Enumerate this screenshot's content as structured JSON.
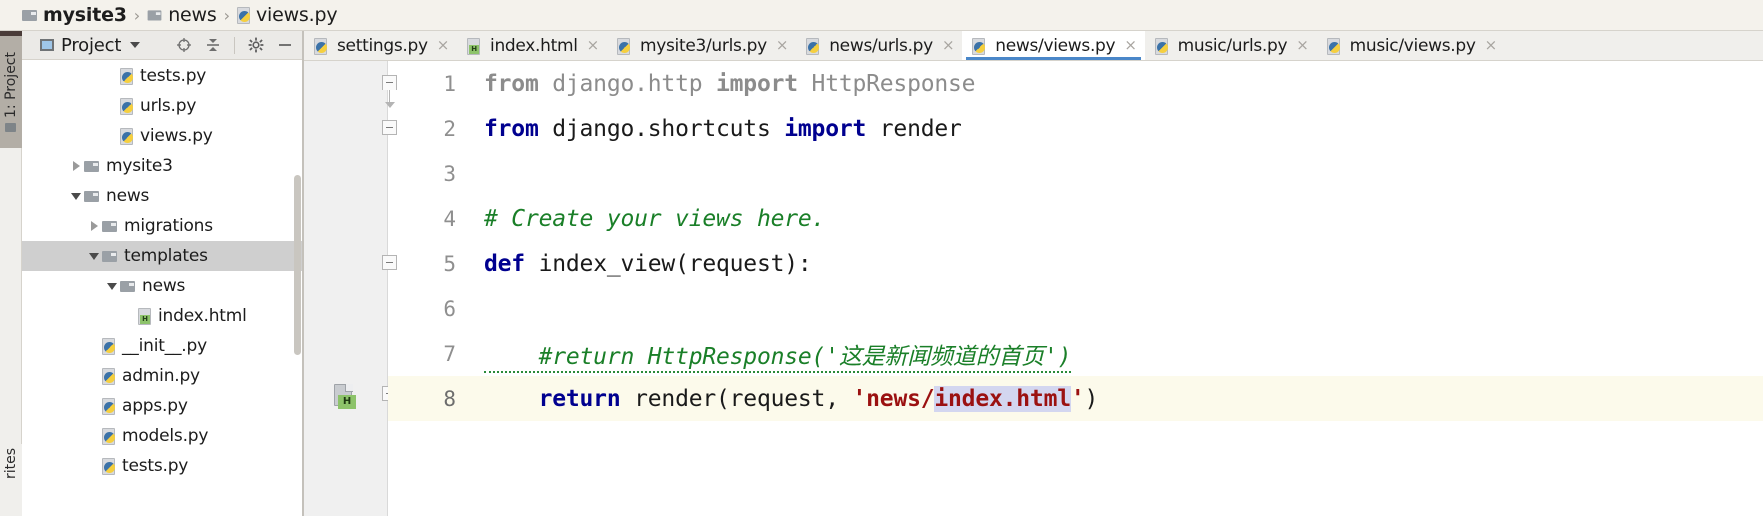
{
  "window": {
    "app": "PyCharm",
    "accent_color": "#4a87c9",
    "selection_color": "#d3d6f0",
    "current_line_color": "#fcfaeb",
    "tree_selection_color": "#cfcfcf"
  },
  "breadcrumb": {
    "items": [
      {
        "label": "mysite3",
        "icon": "folder-icon",
        "bold": true
      },
      {
        "label": "news",
        "icon": "folder-icon",
        "bold": false
      },
      {
        "label": "views.py",
        "icon": "python-file-icon",
        "bold": false
      }
    ],
    "separator": "›"
  },
  "toolstrip": {
    "project_button": {
      "label": "1: Project",
      "number": "1",
      "text": "Project",
      "icon": "folder-icon"
    },
    "favorites_button": {
      "label": "rites",
      "full_label": "Favorites"
    }
  },
  "project_panel": {
    "title": "Project",
    "caret": "chevron-down-icon",
    "toolbar_icons": [
      {
        "name": "locate-target-icon",
        "title": "Select Opened File"
      },
      {
        "name": "collapse-all-icon",
        "title": "Collapse All"
      },
      {
        "name": "gear-icon",
        "title": "Settings"
      },
      {
        "name": "minimize-icon",
        "title": "Hide"
      }
    ],
    "tree": [
      {
        "label": "tests.py",
        "icon": "python-file-icon",
        "indent": 4,
        "twisty": "none",
        "selected": false
      },
      {
        "label": "urls.py",
        "icon": "python-file-icon",
        "indent": 4,
        "twisty": "none",
        "selected": false
      },
      {
        "label": "views.py",
        "icon": "python-file-icon",
        "indent": 4,
        "twisty": "none",
        "selected": false
      },
      {
        "label": "mysite3",
        "icon": "folder-icon",
        "indent": 2,
        "twisty": "collapsed",
        "selected": false
      },
      {
        "label": "news",
        "icon": "folder-icon",
        "indent": 2,
        "twisty": "expanded",
        "selected": false
      },
      {
        "label": "migrations",
        "icon": "folder-icon",
        "indent": 3,
        "twisty": "collapsed",
        "selected": false
      },
      {
        "label": "templates",
        "icon": "folder-icon",
        "indent": 3,
        "twisty": "expanded",
        "selected": true
      },
      {
        "label": "news",
        "icon": "folder-icon",
        "indent": 4,
        "twisty": "expanded",
        "selected": false
      },
      {
        "label": "index.html",
        "icon": "html-file-icon",
        "indent": 5,
        "twisty": "none",
        "selected": false
      },
      {
        "label": "__init__.py",
        "icon": "python-file-icon",
        "indent": 3,
        "twisty": "none",
        "selected": false
      },
      {
        "label": "admin.py",
        "icon": "python-file-icon",
        "indent": 3,
        "twisty": "none",
        "selected": false
      },
      {
        "label": "apps.py",
        "icon": "python-file-icon",
        "indent": 3,
        "twisty": "none",
        "selected": false
      },
      {
        "label": "models.py",
        "icon": "python-file-icon",
        "indent": 3,
        "twisty": "none",
        "selected": false
      },
      {
        "label": "tests.py",
        "icon": "python-file-icon",
        "indent": 3,
        "twisty": "none",
        "selected": false
      }
    ]
  },
  "editor_tabs": {
    "close_glyph": "×",
    "items": [
      {
        "label": "settings.py",
        "icon": "python-file-icon",
        "active": false
      },
      {
        "label": "index.html",
        "icon": "html-file-icon",
        "active": false
      },
      {
        "label": "mysite3/urls.py",
        "icon": "python-file-icon",
        "active": false
      },
      {
        "label": "news/urls.py",
        "icon": "python-file-icon",
        "active": false
      },
      {
        "label": "news/views.py",
        "icon": "python-file-icon",
        "active": true
      },
      {
        "label": "music/urls.py",
        "icon": "python-file-icon",
        "active": false
      },
      {
        "label": "music/views.py",
        "icon": "python-file-icon",
        "active": false
      }
    ]
  },
  "code": {
    "filename": "news/views.py",
    "lines": [
      {
        "number": "1",
        "current": false,
        "tokens": [
          {
            "t": "from",
            "c": "dimb"
          },
          {
            "t": " django.http ",
            "c": "dim"
          },
          {
            "t": "import",
            "c": "dimb"
          },
          {
            "t": " HttpResponse",
            "c": "dim"
          }
        ]
      },
      {
        "number": "2",
        "current": false,
        "tokens": [
          {
            "t": "from",
            "c": "kw"
          },
          {
            "t": " django.shortcuts ",
            "c": "plain"
          },
          {
            "t": "import",
            "c": "kw"
          },
          {
            "t": " render",
            "c": "plain"
          }
        ]
      },
      {
        "number": "3",
        "current": false,
        "tokens": []
      },
      {
        "number": "4",
        "current": false,
        "tokens": [
          {
            "t": "# Create your views here.",
            "c": "cmt"
          }
        ]
      },
      {
        "number": "5",
        "current": false,
        "tokens": [
          {
            "t": "def",
            "c": "kw"
          },
          {
            "t": " index_view(request):",
            "c": "plain"
          }
        ]
      },
      {
        "number": "6",
        "current": false,
        "tokens": []
      },
      {
        "number": "7",
        "current": false,
        "tokens": [
          {
            "t": "    #return HttpResponse('这是新闻频道的首页')",
            "c": "cmt squig"
          }
        ]
      },
      {
        "number": "8",
        "current": true,
        "tokens": [
          {
            "t": "    ",
            "c": "plain"
          },
          {
            "t": "return",
            "c": "kw"
          },
          {
            "t": " render(request, ",
            "c": "plain"
          },
          {
            "t": "'news/",
            "c": "str"
          },
          {
            "t": "index.html",
            "c": "str sel"
          },
          {
            "t": "'",
            "c": "str"
          },
          {
            "t": ")",
            "c": "plain"
          }
        ]
      }
    ],
    "gutter_icons": {
      "line8_html_reference": {
        "name": "html-file-gutter-icon",
        "badge": "H"
      },
      "line8_intention_bulb": {
        "name": "lightbulb-icon"
      }
    }
  }
}
